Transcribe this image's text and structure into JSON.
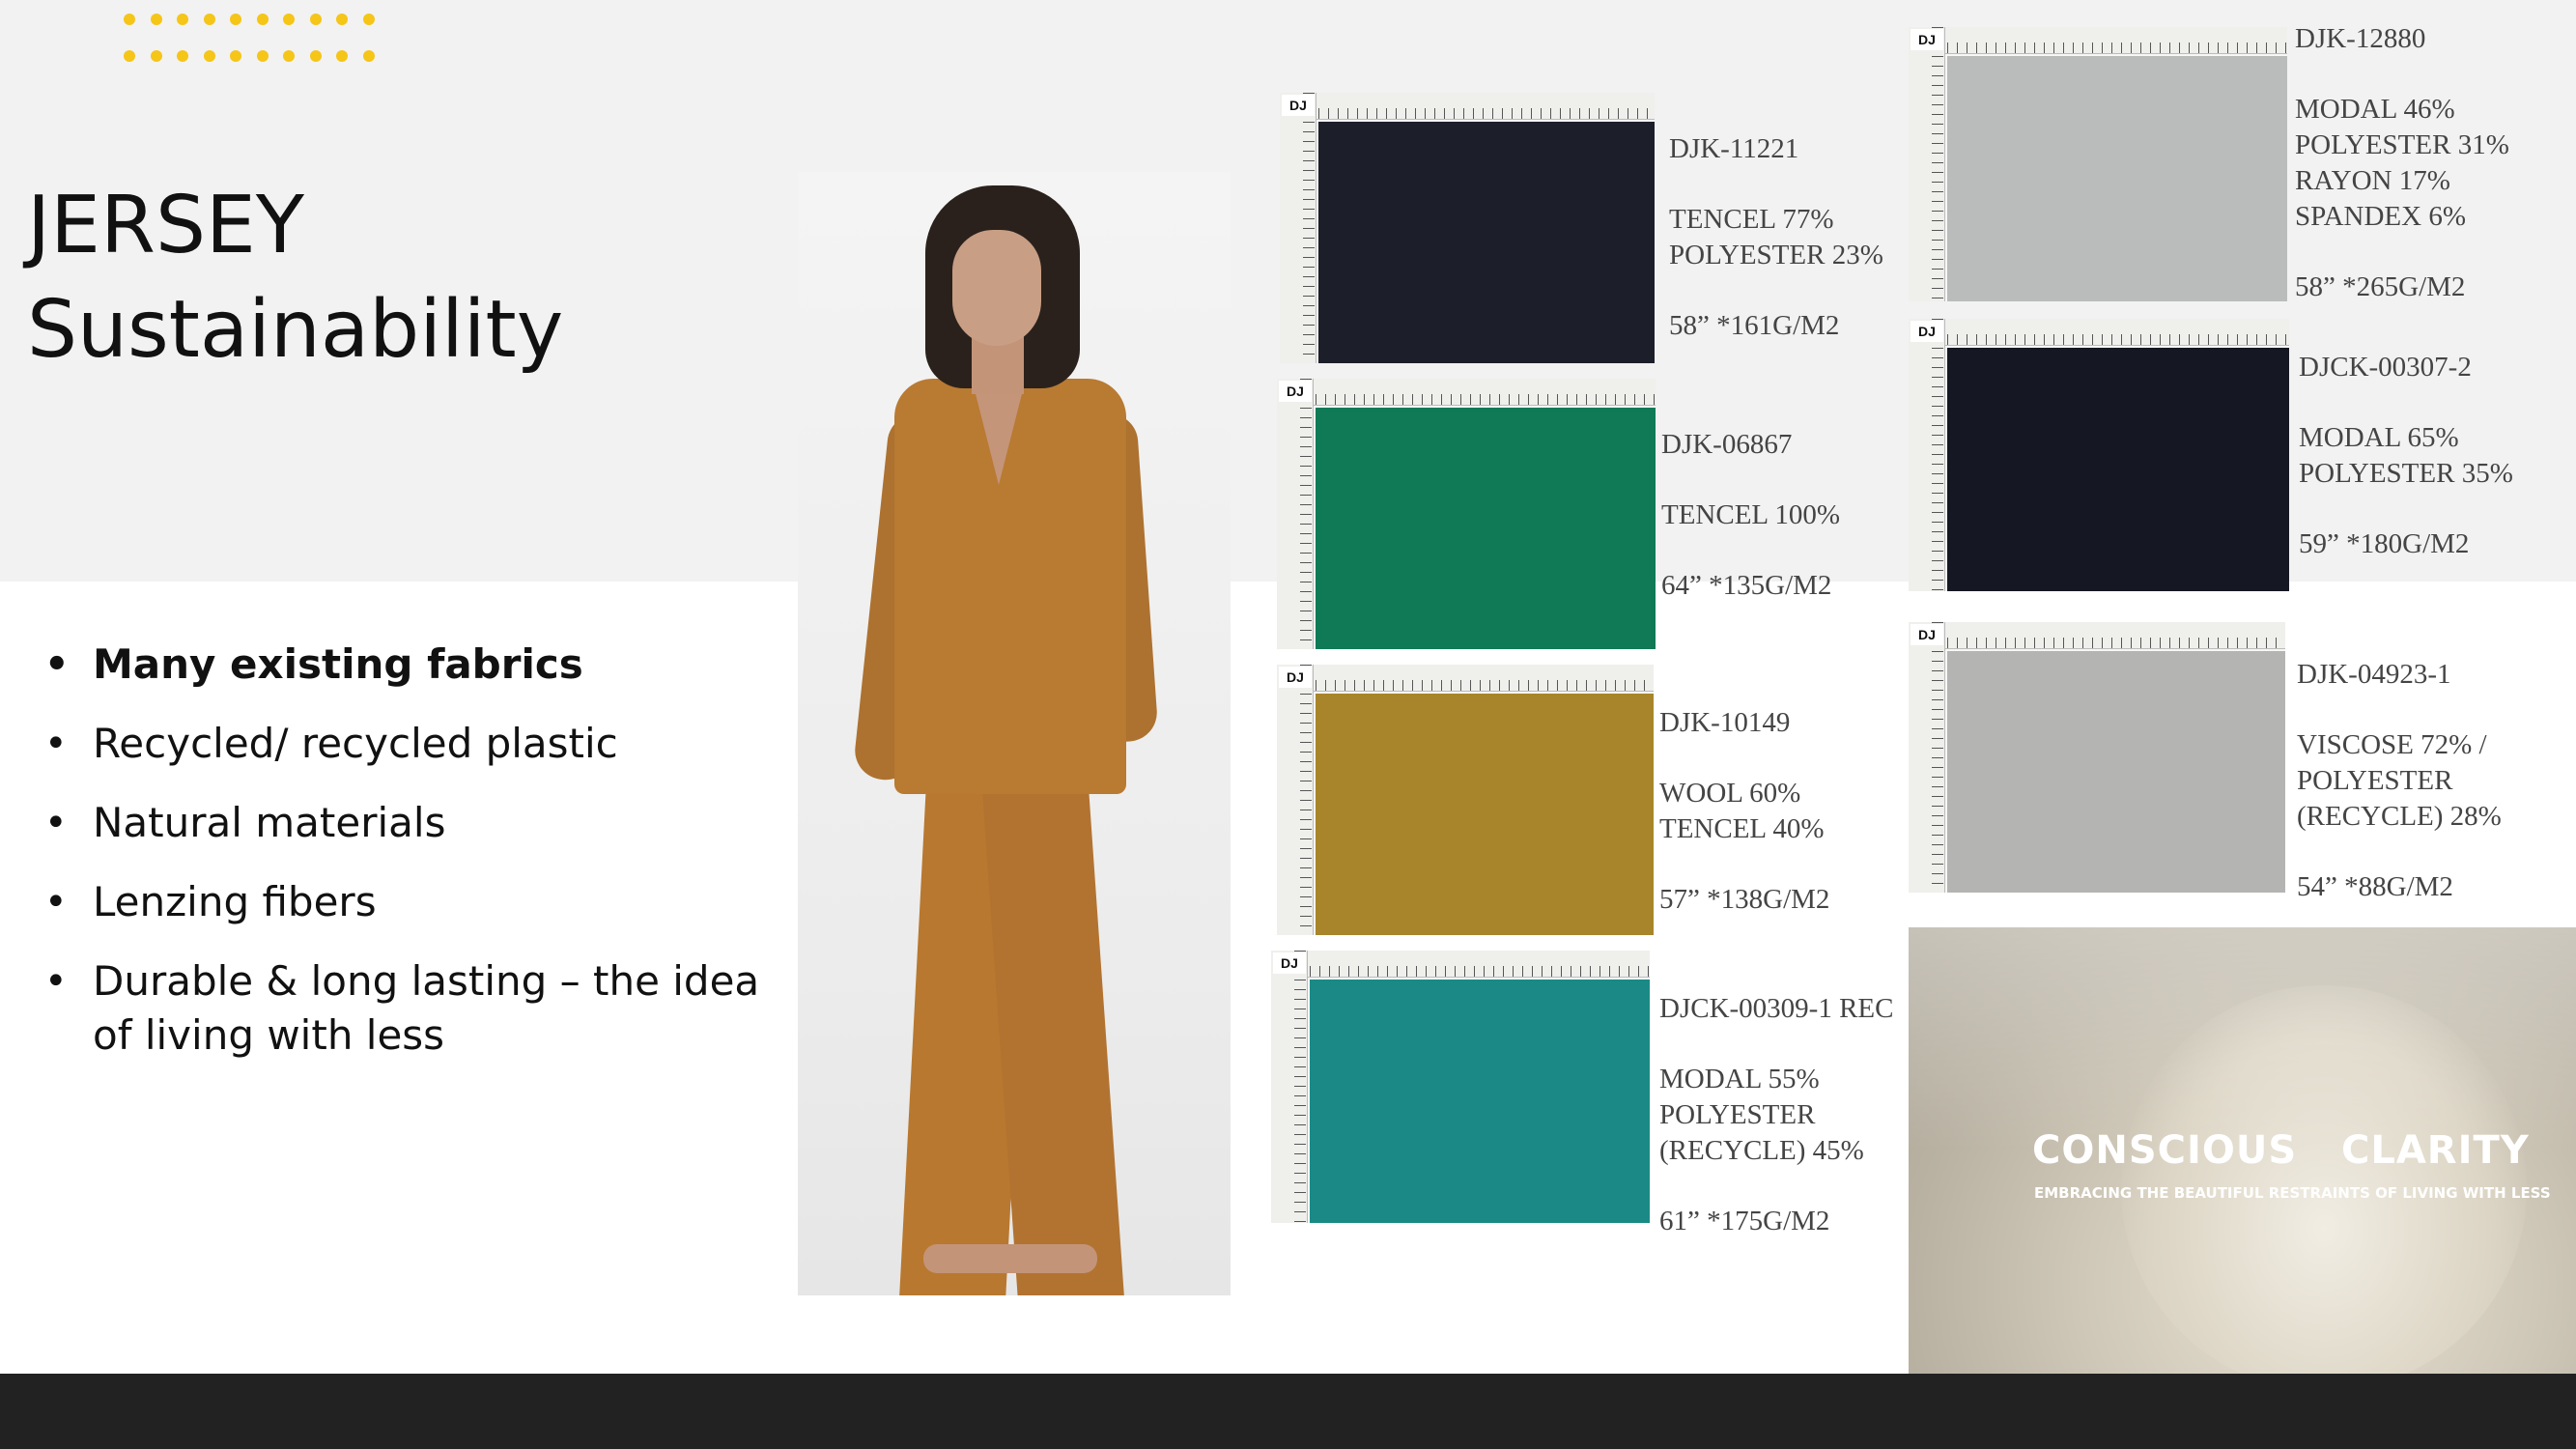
{
  "slide": {
    "title_line1": "JERSEY",
    "title_line2": "Sustainability"
  },
  "bullets": [
    {
      "text": "Many existing fabrics",
      "bold": true
    },
    {
      "text": "Recycled/ recycled plastic",
      "bold": false
    },
    {
      "text": "Natural materials",
      "bold": false
    },
    {
      "text": "Lenzing fibers",
      "bold": false
    },
    {
      "text": "Durable & long lasting – the idea of living with less",
      "bold": false
    }
  ],
  "swatches": [
    {
      "code": "DJK-11221",
      "composition": [
        "TENCEL  77%",
        "POLYESTER  23%"
      ],
      "weight": "58”  *161G/M2",
      "color": "#1c1f2a"
    },
    {
      "code": "DJK-06867",
      "composition": [
        "TENCEL  100%"
      ],
      "weight": "64”  *135G/M2",
      "color": "#0f7a55"
    },
    {
      "code": "DJK-10149",
      "composition": [
        "WOOL  60%",
        "TENCEL  40%"
      ],
      "weight": "57”  *138G/M2",
      "color": "#a8852a"
    },
    {
      "code": "DJCK-00309-1 REC",
      "composition": [
        "MODAL 55%",
        "POLYESTER",
        "(RECYCLE) 45%"
      ],
      "weight": "61”  *175G/M2",
      "color": "#1b8a86"
    },
    {
      "code": "DJK-12880",
      "composition": [
        "MODAL 46%",
        "POLYESTER 31%",
        "RAYON 17%",
        "SPANDEX 6%"
      ],
      "weight": "58”  *265G/M2",
      "color": "#b9bcbb"
    },
    {
      "code": "DJCK-00307-2",
      "composition": [
        "MODAL  65%",
        "POLYESTER  35%"
      ],
      "weight": "59”  *180G/M2",
      "color": "#151822"
    },
    {
      "code": "DJK-04923-1",
      "composition": [
        "VISCOSE  72% /",
        "POLYESTER",
        "(RECYCLE)  28%"
      ],
      "weight": "54”  *88G/M2",
      "color": "#b4b4b2"
    }
  ],
  "swatch_logo": "DJ",
  "clarity": {
    "title_word1": "CONSCIOUS",
    "title_word2": "CLARITY",
    "subtitle": "EMBRACING THE BEAUTIFUL RESTRAINTS OF LIVING WITH LESS"
  },
  "colors": {
    "accent_dots": "#f5c518",
    "footer": "#222222",
    "top_band": "#f2f2f2"
  }
}
